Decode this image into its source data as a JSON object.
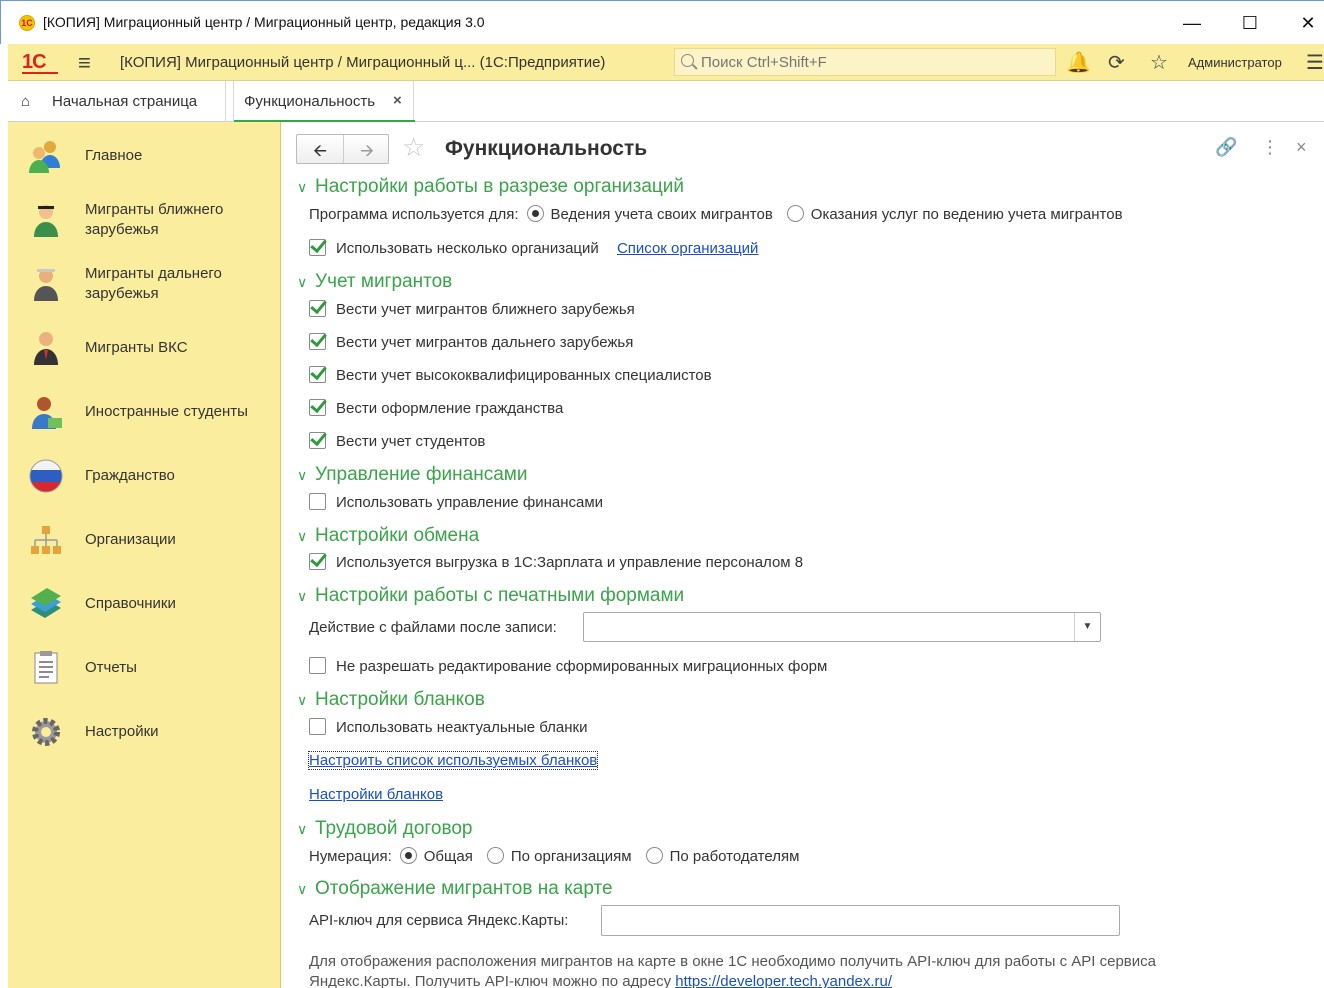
{
  "window": {
    "title": "[КОПИЯ] Миграционный центр / Миграционный центр, редакция 3.0",
    "logo_text": "1С"
  },
  "appbar": {
    "brand": "1С",
    "title": "[КОПИЯ] Миграционный центр / Миграционный ц...  (1С:Предприятие)",
    "search_placeholder": "Поиск Ctrl+Shift+F",
    "user": "Администратор"
  },
  "tabs": {
    "home": "Начальная страница",
    "active": "Функциональность"
  },
  "sidebar": {
    "items": [
      {
        "label": "Главное",
        "icon": "people-icon"
      },
      {
        "label": "Мигранты ближнего\nзарубежья",
        "icon": "migrant-near-icon"
      },
      {
        "label": "Мигранты дальнего\nзарубежья",
        "icon": "migrant-far-icon"
      },
      {
        "label": "Мигранты ВКС",
        "icon": "specialist-icon"
      },
      {
        "label": "Иностранные студенты",
        "icon": "student-icon"
      },
      {
        "label": "Гражданство",
        "icon": "flag-icon"
      },
      {
        "label": "Организации",
        "icon": "org-tree-icon"
      },
      {
        "label": "Справочники",
        "icon": "books-icon"
      },
      {
        "label": "Отчеты",
        "icon": "report-icon"
      },
      {
        "label": "Настройки",
        "icon": "gear-icon"
      }
    ]
  },
  "page": {
    "title": "Функциональность",
    "s1": {
      "title": "Настройки работы в разрезе организаций",
      "used_for": "Программа используется для:",
      "radio1": "Ведения учета своих мигрантов",
      "radio2": "Оказания услуг по ведению учета мигрантов",
      "multi_org": "Использовать несколько организаций",
      "org_list": "Список организаций"
    },
    "s2": {
      "title": "Учет мигрантов",
      "c1": "Вести учет мигрантов ближнего зарубежья",
      "c2": "Вести учет мигрантов дальнего зарубежья",
      "c3": "Вести учет высококвалифицированных специалистов",
      "c4": "Вести оформление гражданства",
      "c5": "Вести учет студентов"
    },
    "s3": {
      "title": "Управление финансами",
      "c1": "Использовать управление финансами"
    },
    "s4": {
      "title": "Настройки обмена",
      "c1": "Используется выгрузка в 1С:Зарплата и управление персоналом 8"
    },
    "s5": {
      "title": "Настройки работы с печатными формами",
      "action_label": "Действие с файлами после записи:",
      "action_value": "",
      "c1": "Не разрешать редактирование сформированных миграционных форм"
    },
    "s6": {
      "title": "Настройки бланков",
      "c1": "Использовать неактуальные бланки",
      "link1": "Настроить список используемых бланков",
      "link2": "Настройки бланков"
    },
    "s7": {
      "title": "Трудовой договор",
      "numbering": "Нумерация:",
      "r1": "Общая",
      "r2": "По организациям",
      "r3": "По работодателям"
    },
    "s8": {
      "title": "Отображение мигрантов на карте",
      "api_label": "API-ключ для сервиса Яндекс.Карты:",
      "api_value": "",
      "note1": "Для отображения расположения мигрантов на карте в окне 1С необходимо получить API-ключ для работы с API сервиса",
      "note2": "Яндекс.Карты. Получить API-ключ можно по адресу",
      "note_link": "https://developer.tech.yandex.ru/"
    }
  }
}
